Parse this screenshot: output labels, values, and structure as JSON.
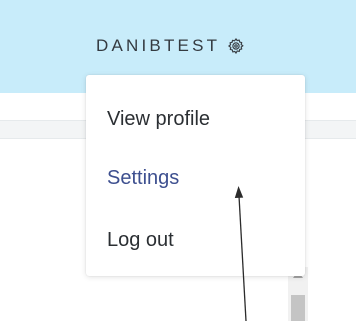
{
  "header": {
    "username": "DANIBTEST",
    "settings_icon": "gear-icon",
    "background_color": "#c8ecfa"
  },
  "user_menu": {
    "items": [
      {
        "label": "View profile"
      },
      {
        "label": "Settings"
      },
      {
        "label": "Log out"
      }
    ],
    "active_color": "#3d4f8f"
  },
  "annotation": {
    "icon": "arrow-up-icon",
    "color": "#2b2b2b"
  },
  "scrollbar": {
    "icon": "scroll-up-arrow-icon"
  }
}
